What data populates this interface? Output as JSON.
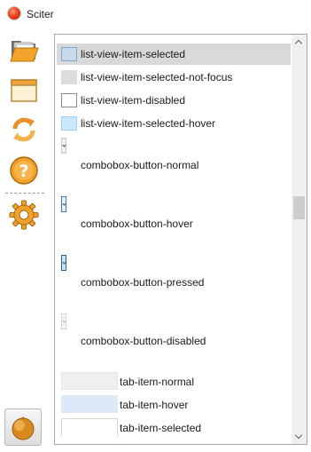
{
  "window": {
    "title": "Sciter"
  },
  "sidebar": {
    "items": [
      {
        "icon": "folder-open-icon"
      },
      {
        "icon": "window-icon"
      },
      {
        "icon": "refresh-icon"
      },
      {
        "icon": "help-icon"
      },
      {
        "icon": "gear-icon"
      },
      {
        "icon": "ball-icon",
        "active": true
      }
    ]
  },
  "list": {
    "rows": [
      {
        "label": "list-view-item-selected"
      },
      {
        "label": "list-view-item-selected-not-focus"
      },
      {
        "label": "list-view-item-disabled"
      },
      {
        "label": "list-view-item-selected-hover"
      },
      {
        "label": "combobox-button-normal"
      },
      {
        "label": "combobox-button-hover"
      },
      {
        "label": "combobox-button-pressed"
      },
      {
        "label": "combobox-button-disabled"
      },
      {
        "label": "tab-item-normal"
      },
      {
        "label": "tab-item-hover"
      },
      {
        "label": "tab-item-selected"
      }
    ]
  },
  "colors": {
    "selected_row": "#d9d9d9",
    "selected_swatch": "#c8d9ea",
    "not_focus_swatch": "#dcdcdc",
    "hover_swatch": "#cce8ff",
    "tab_normal": "#efefef",
    "tab_hover": "#dbe9f9",
    "tab_selected": "#ffffff"
  }
}
